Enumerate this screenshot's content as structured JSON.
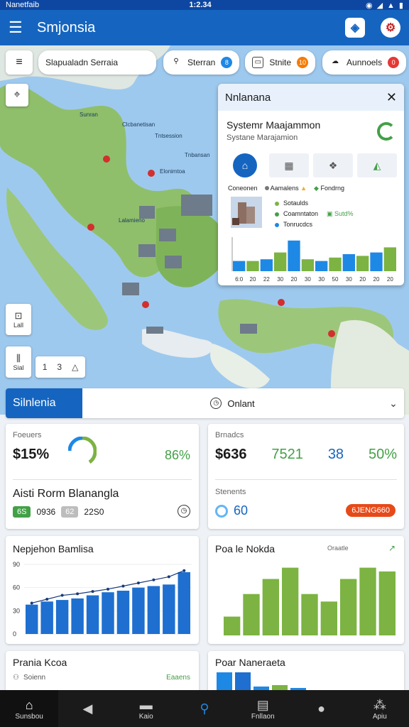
{
  "status": {
    "carrier": "Nanetfaib",
    "time": "1:2.34"
  },
  "appbar": {
    "title": "Smjonsia"
  },
  "map": {
    "search_placeholder": "Slapualadn Serraia",
    "chips": [
      {
        "label": "Sterran",
        "badge": "8",
        "badge_color": "#1e88e5"
      },
      {
        "label": "Stnite",
        "badge": "10",
        "badge_color": "#f57c00"
      },
      {
        "label": "Aunnoels",
        "badge": "0",
        "badge_color": "#e53935"
      }
    ],
    "place_labels": [
      "Sunran",
      "Clcbanetisan",
      "Tntsession",
      "Tnbansan",
      "Elonimtoa",
      "Lalamieno"
    ],
    "ctrl_top_label": "Lall",
    "ctrl_bottom_label": "Sial",
    "zoom_values": [
      "1",
      "3"
    ]
  },
  "panel": {
    "header": "Nnlanana",
    "title": "Systemr Maajammon",
    "subtitle": "Systane Marajamion",
    "legend": [
      {
        "label": "Coneonen",
        "color": "#555555"
      },
      {
        "label": "Aamalens",
        "color": "#f9a825"
      },
      {
        "label": "Fondrng",
        "color": "#43a047"
      }
    ],
    "rows": [
      {
        "label": "Sotaulds",
        "color": "#7cb342"
      },
      {
        "label": "Coamntaton",
        "color": "#43a047",
        "extra": "Sutd%"
      },
      {
        "label": "Tonrucdcs",
        "color": "#1e88e5"
      }
    ],
    "x_labels": [
      "6:0",
      "20",
      "22",
      "30",
      "20",
      "30",
      "30",
      "50",
      "30",
      "20",
      "20",
      "20"
    ]
  },
  "strip": {
    "tag": "Silnlenia",
    "center": "Onlant"
  },
  "cards": {
    "c1": {
      "label": "Foeuers",
      "value": "$15%",
      "percent": "86%",
      "name": "Aisti Rorm Blanangla",
      "pill1": "6S",
      "val1": "0936",
      "pill2": "62",
      "val2": "22S0"
    },
    "c2": {
      "label": "Brnadcs",
      "value": "$636",
      "value2": "7521",
      "value3": "38",
      "percent": "50%",
      "label2": "Stenents",
      "score": "60",
      "status": "6JENG660"
    },
    "c3": {
      "title": "Nepjehon Bamlisa",
      "y_labels": [
        "90",
        "60",
        "30",
        "0"
      ]
    },
    "c4": {
      "title": "Poa le Nokda",
      "legend": "Oraatle"
    },
    "c5": {
      "title": "Prania Kcoa",
      "sub": "Soienn",
      "right": "Eaaens"
    },
    "c6": {
      "title": "Poar Naneraeta"
    }
  },
  "chart_data": [
    {
      "type": "bar",
      "title": "Nepjehon Bamlisa",
      "categories": [
        "1",
        "2",
        "3",
        "4",
        "5",
        "6",
        "7",
        "8",
        "9",
        "10",
        "11"
      ],
      "series": [
        {
          "type": "bar",
          "values": [
            38,
            42,
            44,
            46,
            50,
            54,
            56,
            60,
            62,
            64,
            80
          ]
        },
        {
          "type": "line",
          "values": [
            40,
            45,
            50,
            52,
            55,
            58,
            62,
            66,
            70,
            74,
            82
          ]
        }
      ],
      "ylim": [
        0,
        90
      ],
      "yticks": [
        "90",
        "60",
        "30",
        "0"
      ]
    },
    {
      "type": "bar",
      "title": "Poa le Nokda",
      "categories": [
        "1",
        "2",
        "3",
        "4",
        "5",
        "6",
        "7",
        "8"
      ],
      "values": [
        25,
        55,
        75,
        90,
        55,
        45,
        75,
        90,
        85
      ],
      "color": "#7cb342"
    },
    {
      "type": "bar",
      "categories": [
        "1",
        "2",
        "3",
        "4",
        "5",
        "6",
        "7",
        "8",
        "9",
        "10",
        "11",
        "12"
      ],
      "values": [
        12,
        12,
        14,
        22,
        36,
        14,
        12,
        16,
        20,
        18,
        22,
        28
      ],
      "colors": [
        "#1e88e5",
        "#7cb342"
      ]
    }
  ],
  "nav": [
    {
      "label": "Sunsbou",
      "icon": "home-icon",
      "active": true
    },
    {
      "label": "",
      "icon": "back-icon",
      "active": false
    },
    {
      "label": "Kaio",
      "icon": "card-icon",
      "active": false
    },
    {
      "label": "",
      "icon": "search-icon",
      "active": false
    },
    {
      "label": "Fnllaon",
      "icon": "news-icon",
      "active": false
    },
    {
      "label": "",
      "icon": "circle-icon",
      "active": false
    },
    {
      "label": "Apiu",
      "icon": "grid-icon",
      "active": false
    }
  ]
}
